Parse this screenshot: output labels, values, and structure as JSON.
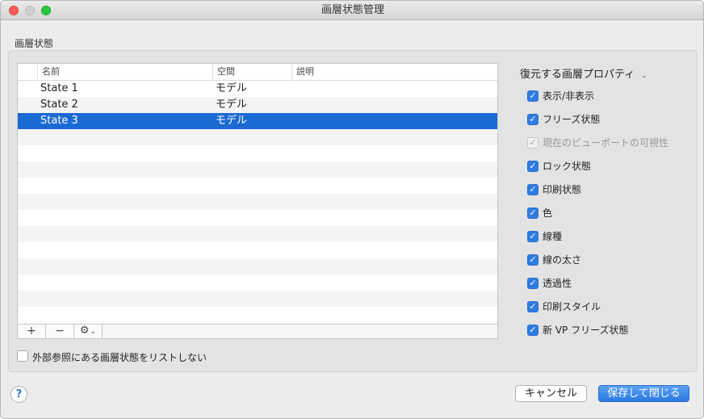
{
  "window": {
    "title": "画層状態管理"
  },
  "section": {
    "label": "画層状態"
  },
  "table": {
    "columns": [
      "名前",
      "空間",
      "説明"
    ],
    "rows": [
      {
        "name": "State 1",
        "space": "モデル",
        "description": ""
      },
      {
        "name": "State 2",
        "space": "モデル",
        "description": ""
      },
      {
        "name": "State 3",
        "space": "モデル",
        "description": "",
        "selected": true
      }
    ]
  },
  "toolbar": {
    "add_label": "+",
    "remove_label": "−",
    "gear_icon": "gear-icon"
  },
  "external_ref_checkbox": {
    "label": "外部参照にある画層状態をリストしない",
    "checked": false
  },
  "properties": {
    "header": "復元する画層プロパティ",
    "items": [
      {
        "label": "表示/非表示",
        "checked": true,
        "disabled": false
      },
      {
        "label": "フリーズ状態",
        "checked": true,
        "disabled": false
      },
      {
        "label": "現在のビューポートの可視性",
        "checked": true,
        "disabled": true
      },
      {
        "label": "ロック状態",
        "checked": true,
        "disabled": false
      },
      {
        "label": "印刷状態",
        "checked": true,
        "disabled": false
      },
      {
        "label": "色",
        "checked": true,
        "disabled": false
      },
      {
        "label": "線種",
        "checked": true,
        "disabled": false
      },
      {
        "label": "線の太さ",
        "checked": true,
        "disabled": false
      },
      {
        "label": "透過性",
        "checked": true,
        "disabled": false
      },
      {
        "label": "印刷スタイル",
        "checked": true,
        "disabled": false
      },
      {
        "label": "新 VP フリーズ状態",
        "checked": true,
        "disabled": false
      }
    ]
  },
  "footer": {
    "help_label": "?",
    "cancel_label": "キャンセル",
    "save_label": "保存して閉じる"
  },
  "colors": {
    "selection": "#1b6ad3",
    "accent": "#2f7ce1"
  }
}
